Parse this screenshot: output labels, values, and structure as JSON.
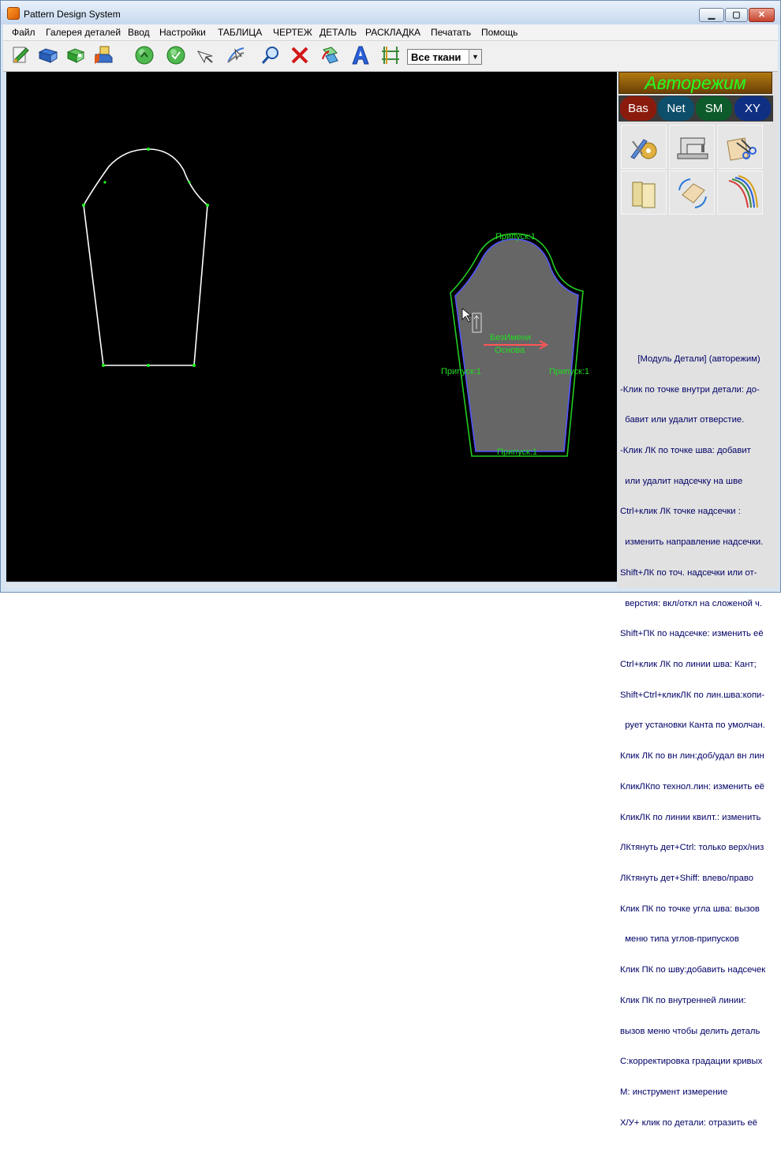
{
  "window": {
    "title": "Pattern Design System"
  },
  "window_controls": {
    "minimize": "▁",
    "maximize": "▢",
    "close": "✕"
  },
  "menu": [
    {
      "label": "Файл"
    },
    {
      "label": "Галерея деталей"
    },
    {
      "label": "Ввод"
    },
    {
      "label": "Настройки"
    },
    {
      "label": "ТАБЛИЦА"
    },
    {
      "label": "ЧЕРТЕЖ"
    },
    {
      "label": "ДЕТАЛЬ"
    },
    {
      "label": "РАСКЛАДКА"
    },
    {
      "label": "Печатать"
    },
    {
      "label": "Помощь"
    }
  ],
  "toolbar": {
    "icons": [
      "new-pattern-icon",
      "open-file-icon",
      "save-icon",
      "print-icon",
      "zoom-in-icon",
      "zoom-out-icon",
      "pointer-icon",
      "transform-icon",
      "search-icon",
      "delete-icon",
      "rotate-icon",
      "text-icon",
      "measure-icon"
    ],
    "fabric_select": {
      "value": "Все ткани"
    }
  },
  "canvas": {
    "detail_labels": {
      "top_allowance": "Припуск:1",
      "left_allowance": "Припуск:1",
      "right_allowance": "Припуск:1",
      "bottom_allowance": "Припуск:1",
      "name": "БезИмени",
      "fabric": "Основа"
    }
  },
  "right_panel": {
    "auto_mode": "Авторежим",
    "mode_buttons": [
      {
        "label": "Bas",
        "color": "#8a1b0c"
      },
      {
        "label": "Net",
        "color": "#0d4f6b"
      },
      {
        "label": "SM",
        "color": "#0d5a2a"
      },
      {
        "label": "XY",
        "color": "#0f2f82"
      }
    ],
    "tool_icons": [
      "draft-tools-icon",
      "sewing-machine-icon",
      "cut-scissors-icon",
      "fabric-roll-icon",
      "rotate-piece-icon",
      "curve-lines-icon"
    ],
    "help_title": "[Модуль Детали] (авторежим)",
    "help_lines": [
      "-Клик по точке внутри детали: до-",
      "  бавит или удалит отверстие.",
      "-Клик ЛК по точке шва: добавит",
      "  или удалит надсечку на шве",
      "Ctrl+клик ЛК точке надсечки :",
      "  изменить направление надсечки.",
      "Shift+ЛК по точ. надсечки или от-",
      "  верстия: вкл/откл на сложеной ч.",
      "Shift+ПК по надсечке: изменить её",
      "Ctrl+клик ЛК по линии шва: Кант;",
      "Shift+Ctrl+кликЛК по лин.шва:копи-",
      "  рует установки Канта по умолчан.",
      "Клик ЛК по вн лин:доб/удал вн лин",
      "КликЛКпо технол.лин: изменить её",
      "КликЛК по линии квилт.: изменить",
      "ЛКтянуть дет+Ctrl: только верх/низ",
      "ЛКтянуть дет+Shiff: влево/право",
      "Клик ПК по точке угла шва: вызов",
      "  меню типа углов-припусков",
      "Клик ПК по шву:добавить надсечек",
      "Клик ПК по внутренней линии:",
      "вызов меню чтобы делить деталь",
      "C:корректировка градации кривых",
      "M: инструмент измерение",
      "X/У+ клик по детали: отразить её"
    ]
  },
  "colors": {
    "canvas_bg": "#000000",
    "pattern_line": "#ffffff",
    "point_marker": "#22ff22",
    "allowance_line": "#22cc22",
    "seam_line": "#5555ff",
    "detail_fill": "#666666",
    "grainline": "#ff5555"
  }
}
